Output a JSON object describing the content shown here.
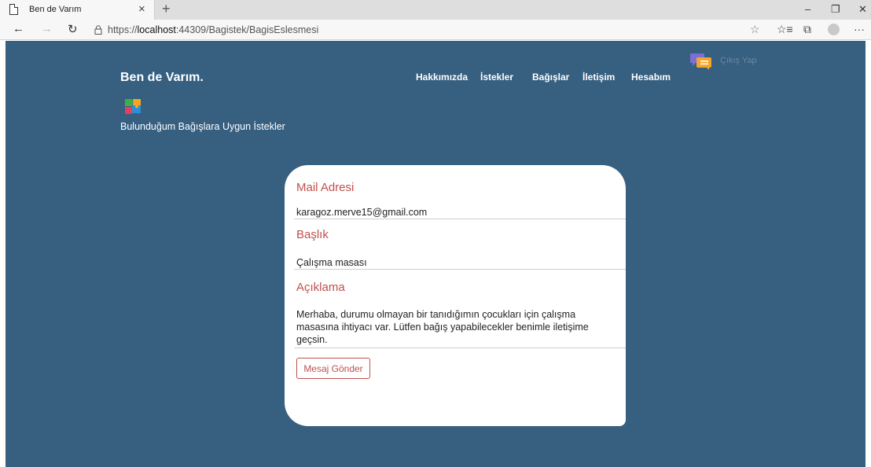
{
  "browser": {
    "tab_title": "Ben de Varım",
    "tab_close": "×",
    "new_tab": "+",
    "url_prefix": "https://",
    "url_host": "localhost",
    "url_path": ":44309/Bagistek/BagisEslesmesi",
    "minimize": "–",
    "restore": "❐",
    "close": "✕",
    "more": "···"
  },
  "navbar": {
    "brand": "Ben de Varım.",
    "items": [
      "Hakkımızda",
      "İstekler",
      "Bağışlar",
      "İletişim",
      "Hesabım"
    ],
    "logout": "Çıkış Yap"
  },
  "page": {
    "subtitle": "Bulunduğum Bağışlara Uygun İstekler"
  },
  "card": {
    "mail_label": "Mail Adresi",
    "mail_value": "karagoz.merve15@gmail.com",
    "title_label": "Başlık",
    "title_value": "Çalışma masası",
    "desc_label": "Açıklama",
    "desc_value": "Merhaba, durumu olmayan bir tanıdığımın çocukları için çalışma masasına ihtiyacı var. Lütfen bağış yapabilecekler benimle iletişime geçsin.",
    "send_button": "Mesaj Gönder"
  },
  "colors": {
    "page_bg": "#365f80",
    "accent": "#c0504d"
  }
}
